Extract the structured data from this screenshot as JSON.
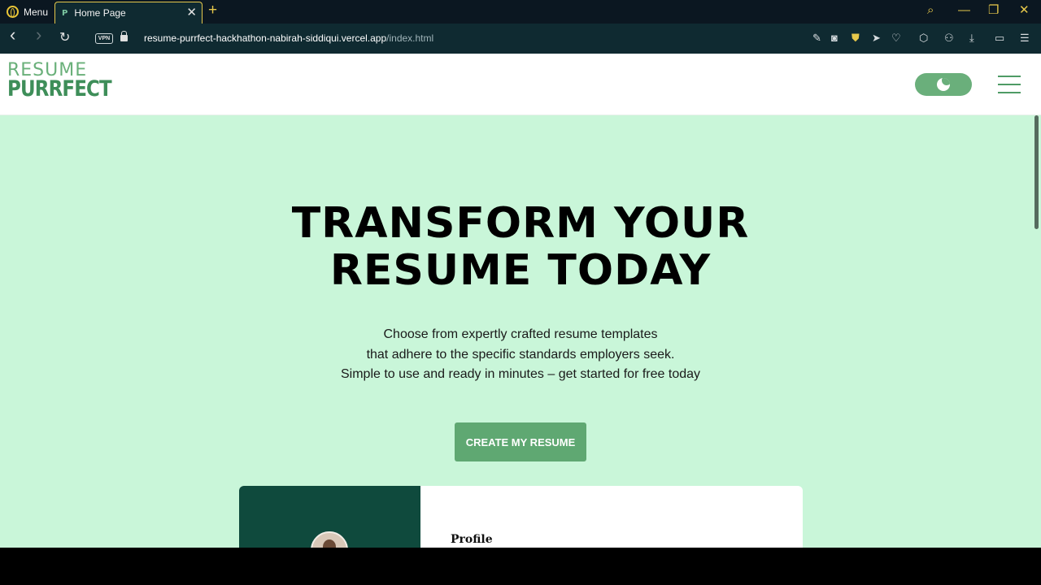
{
  "browser": {
    "menu_label": "Menu",
    "tab": {
      "title": "Home Page",
      "favicon": "P",
      "close": "✕"
    },
    "new_tab": "+",
    "url_domain": "resume-purrfect-hackhathon-nabirah-siddiqui.vercel.app",
    "url_path": "/index.html",
    "vpn_label": "VPN",
    "window_controls": {
      "search": "⌕",
      "minimize": "—",
      "restore": "❐",
      "close": "✕"
    },
    "nav": {
      "back": "‹",
      "forward": "›",
      "reload": "↻"
    },
    "toolbar_icons": [
      "✎",
      "◙",
      "⛊",
      "➤",
      "♡",
      "⬡",
      "⚇",
      "⤓",
      "▭",
      "☰"
    ]
  },
  "site": {
    "logo_top": "RESUME",
    "logo_bottom": "PURRFECT",
    "hero": {
      "title_line1": "TRANSFORM YOUR",
      "title_line2": "RESUME TODAY",
      "sub_line1": "Choose from expertly crafted resume templates",
      "sub_line2": "that adhere to the specific standards employers seek.",
      "sub_line3": "Simple to use and ready in minutes – get started for free today",
      "cta": "CREATE MY RESUME"
    },
    "preview": {
      "heading": "Profile"
    }
  },
  "colors": {
    "page_bg": "#c9f6d9",
    "accent_green": "#5fa872",
    "dark_teal": "#0f4a3d",
    "browser_bg": "#0f2a31",
    "browser_accent": "#e6c84b"
  }
}
